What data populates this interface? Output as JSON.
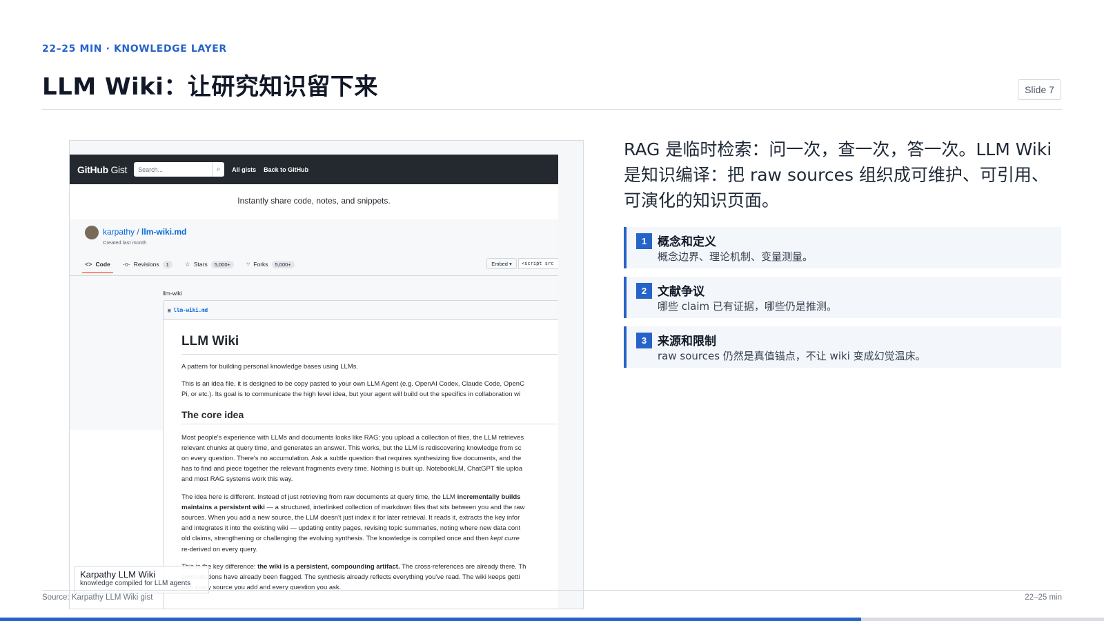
{
  "header": {
    "eyebrow": "22–25 MIN · KNOWLEDGE LAYER",
    "title": "LLM Wiki：让研究知识留下来",
    "slide_label": "Slide 7"
  },
  "screenshot": {
    "gh_logo_bold": "GitHub",
    "gh_logo_light": " Gist",
    "search_placeholder": "Search...",
    "nav_all_gists": "All gists",
    "nav_back": "Back to GitHub",
    "tagline": "Instantly share code, notes, and snippets.",
    "owner": "karpathy",
    "separator": " / ",
    "gist_name": "llm-wiki.md",
    "created": "Created last month",
    "tabs": {
      "code": "Code",
      "revisions": "Revisions",
      "revisions_count": "1",
      "stars": "Stars",
      "stars_count": "5,000+",
      "forks": "Forks",
      "forks_count": "5,000+"
    },
    "embed": "Embed ▾",
    "script_snippet": "<script src",
    "file_description": "llm-wiki",
    "file_name": "llm-wiki.md",
    "md": {
      "h1": "LLM Wiki",
      "p1": "A pattern for building personal knowledge bases using LLMs.",
      "p2a": "This is an idea file, it is designed to be copy pasted to your own LLM Agent (e.g. OpenAI Codex, Claude Code, OpenC",
      "p2b": "Pi, or etc.). Its goal is to communicate the high level idea, but your agent will build out the specifics in collaboration wi",
      "h2": "The core idea",
      "p3a": "Most people's experience with LLMs and documents looks like RAG: you upload a collection of files, the LLM retrieves",
      "p3b": "relevant chunks at query time, and generates an answer. This works, but the LLM is rediscovering knowledge from sc",
      "p3c": "on every question. There's no accumulation. Ask a subtle question that requires synthesizing five documents, and the",
      "p3d": "has to find and piece together the relevant fragments every time. Nothing is built up. NotebookLM, ChatGPT file uploa",
      "p3e": "and most RAG systems work this way.",
      "p4a_plain": "The idea here is different. Instead of just retrieving from raw documents at query time, the LLM ",
      "p4a_bold": "incrementally builds",
      "p4b_bold": "maintains a persistent wiki",
      "p4b_plain": " — a structured, interlinked collection of markdown files that sits between you and the raw",
      "p4c": "sources. When you add a new source, the LLM doesn't just index it for later retrieval. It reads it, extracts the key infor",
      "p4d": "and integrates it into the existing wiki — updating entity pages, revising topic summaries, noting where new data cont",
      "p4e_plain": "old claims, strengthening or challenging the evolving synthesis. The knowledge is compiled once and then ",
      "p4e_italic": "kept curre",
      "p4f": "re-derived on every query.",
      "p5a_plain": "This is the key difference: ",
      "p5a_bold": "the wiki is a persistent, compounding artifact.",
      "p5a_tail": " The cross-references are already there. Th",
      "p5b": "contradictions have already been flagged. The synthesis already reflects everything you've read. The wiki keeps getti",
      "p5c": "with every source you add and every question you ask."
    },
    "caption_title": "Karpathy LLM Wiki",
    "caption_sub": "knowledge compiled for LLM agents"
  },
  "lead": "RAG 是临时检索：问一次，查一次，答一次。LLM Wiki 是知识编译：把 raw sources 组织成可维护、可引用、可演化的知识页面。",
  "cards": [
    {
      "num": "1",
      "title": "概念和定义",
      "body": "概念边界、理论机制、变量测量。"
    },
    {
      "num": "2",
      "title": "文献争议",
      "body": "哪些 claim 已有证据，哪些仍是推测。"
    },
    {
      "num": "3",
      "title": "来源和限制",
      "body": "raw sources 仍然是真值锚点，不让 wiki 变成幻觉温床。"
    }
  ],
  "footer": {
    "source": "Source: Karpathy LLM Wiki gist",
    "timing": "22–25 min",
    "progress": 0.78
  },
  "colors": {
    "accent": "#2563c9",
    "gh_bar": "#24292f",
    "card_bg": "#f3f6fa"
  },
  "icons": [
    "search-icon",
    "code-icon",
    "revisions-icon",
    "star-icon",
    "fork-icon",
    "file-code-icon"
  ]
}
